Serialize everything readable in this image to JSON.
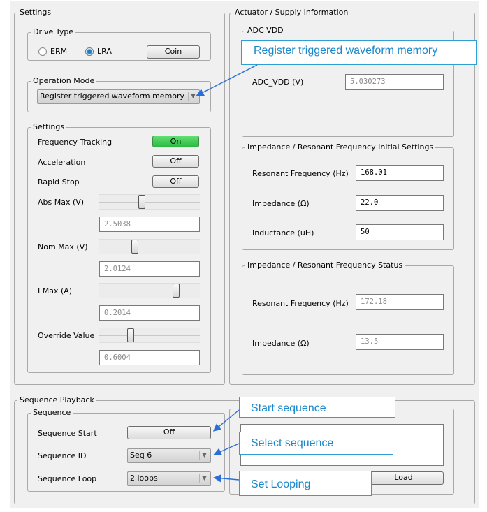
{
  "settings_group": {
    "title": "Settings",
    "drive_type": {
      "title": "Drive Type",
      "erm_label": "ERM",
      "lra_label": "LRA",
      "selected": "LRA",
      "coin_button": "Coin"
    },
    "operation_mode": {
      "title": "Operation Mode",
      "value": "Register triggered waveform memory"
    },
    "inner_settings": {
      "title": "Settings",
      "frequency_tracking": {
        "label": "Frequency Tracking",
        "button": "On"
      },
      "acceleration": {
        "label": "Acceleration",
        "button": "Off"
      },
      "rapid_stop": {
        "label": "Rapid Stop",
        "button": "Off"
      },
      "abs_max": {
        "label": "Abs Max (V)",
        "value": "2.5038"
      },
      "nom_max": {
        "label": "Nom Max (V)",
        "value": "2.0124"
      },
      "i_max": {
        "label": "I Max (A)",
        "value": "0.2014"
      },
      "override": {
        "label": "Override Value",
        "value": "0.6004"
      }
    }
  },
  "actuator_group": {
    "title": "Actuator / Supply Information",
    "adc": {
      "title": "ADC VDD",
      "label": "ADC_VDD (V)",
      "value": "5.030273"
    },
    "initial": {
      "title": "Impedance / Resonant Frequency Initial Settings",
      "resonant_label": "Resonant Frequency (Hz)",
      "resonant_value": "168.01",
      "impedance_label": "Impedance (Ω)",
      "impedance_value": "22.0",
      "inductance_label": "Inductance (uH)",
      "inductance_value": "50"
    },
    "status": {
      "title": "Impedance / Resonant Frequency Status",
      "resonant_label": "Resonant Frequency (Hz)",
      "resonant_value": "172.18",
      "impedance_label": "Impedance (Ω)",
      "impedance_value": "13.5"
    }
  },
  "playback_group": {
    "title": "Sequence Playback",
    "sequence": {
      "title": "Sequence",
      "start_label": "Sequence Start",
      "start_button": "Off",
      "id_label": "Sequence ID",
      "id_value": "Seq 6",
      "loop_label": "Sequence Loop",
      "loop_value": "2 loops"
    },
    "load_button": "Load"
  },
  "callouts": {
    "register": "Register triggered waveform memory",
    "start": "Start sequence",
    "select": "Select sequence",
    "looping": "Set Looping"
  },
  "colors": {
    "callout_accent": "#1a88c9",
    "on_green": "#3cc350"
  },
  "slider_levels": {
    "abs_max": 0.42,
    "nom_max": 0.34,
    "i_max": 0.78,
    "override": 0.3
  }
}
